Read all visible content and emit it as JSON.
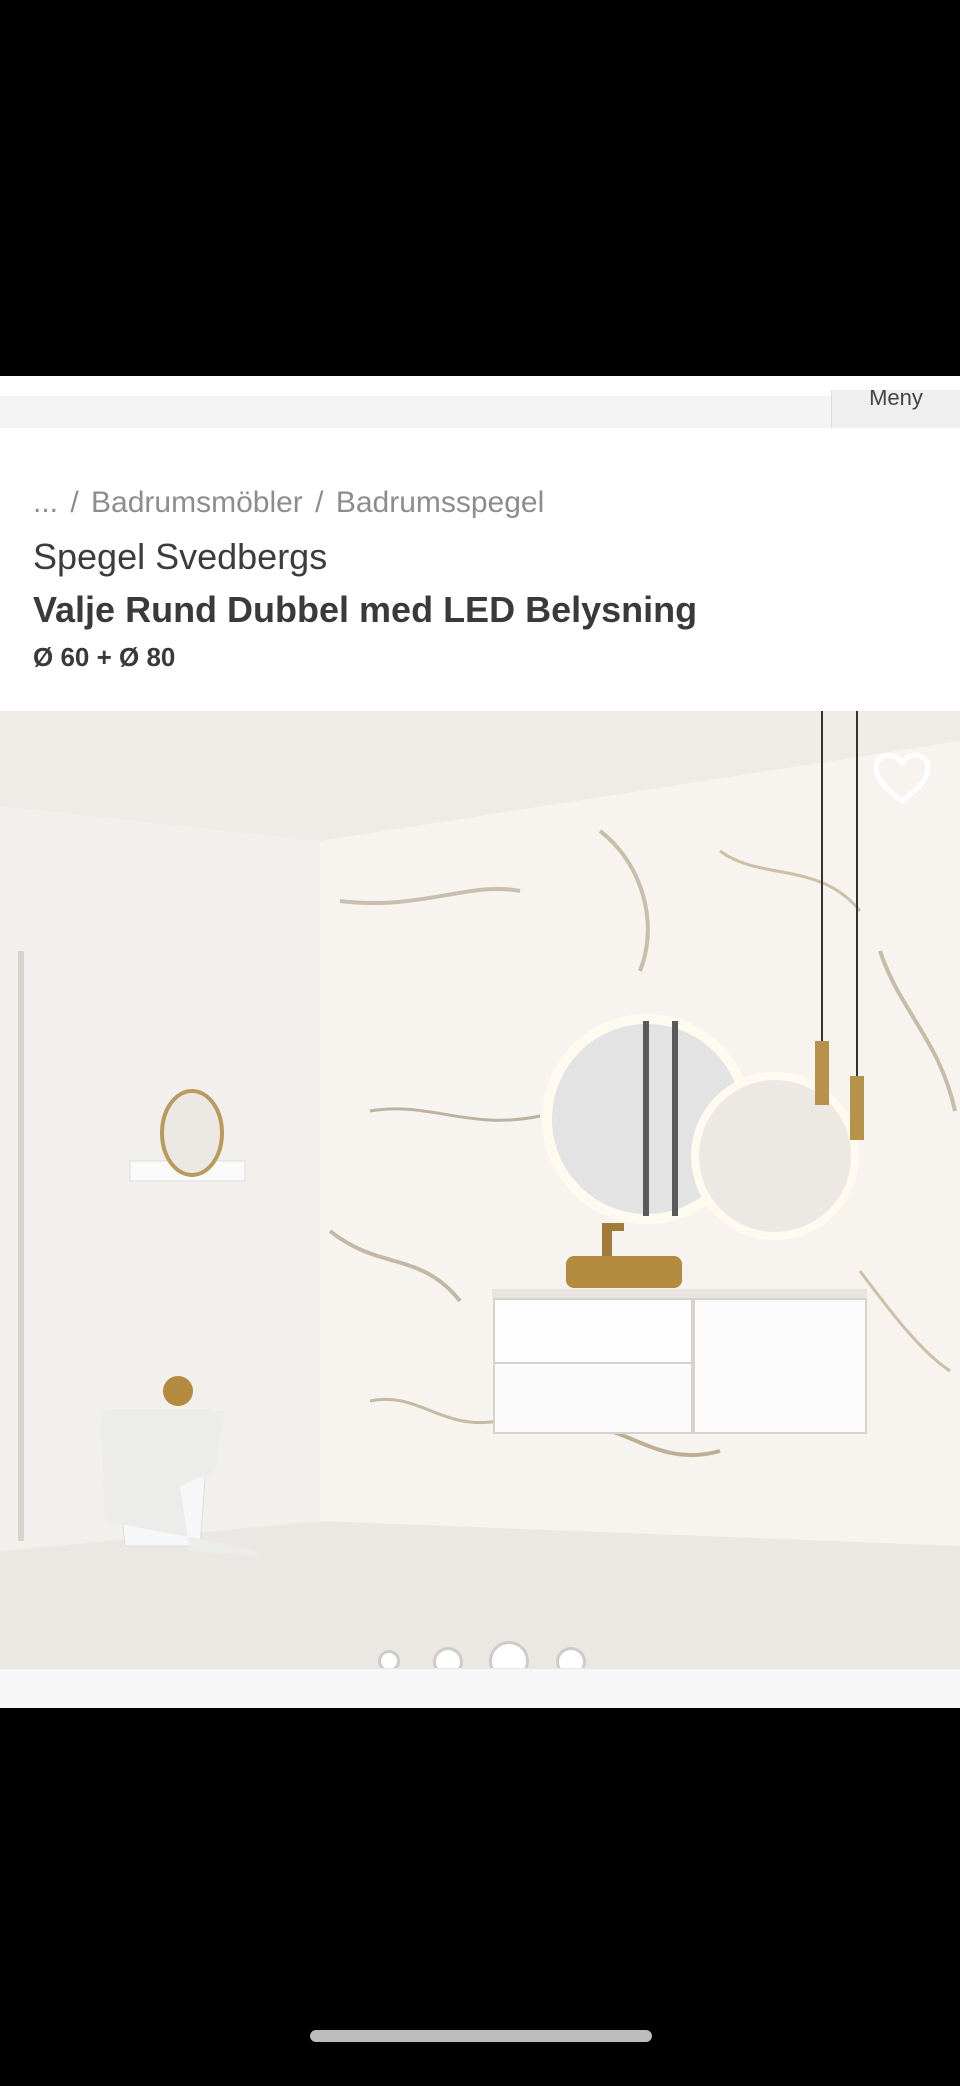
{
  "header": {
    "menu_label": "Meny"
  },
  "breadcrumb": {
    "ellipsis": "...",
    "separator": "/",
    "level1": "Badrumsmöbler",
    "level2": "Badrumsspegel"
  },
  "product": {
    "brand_line": "Spegel Svedbergs",
    "name": "Valje Rund Dubbel med LED Belysning",
    "sizes": "Ø 60 + Ø 80"
  },
  "gallery": {
    "total_images": 4,
    "active_index": 2
  },
  "icons": {
    "favorite": "heart-outline-icon"
  }
}
